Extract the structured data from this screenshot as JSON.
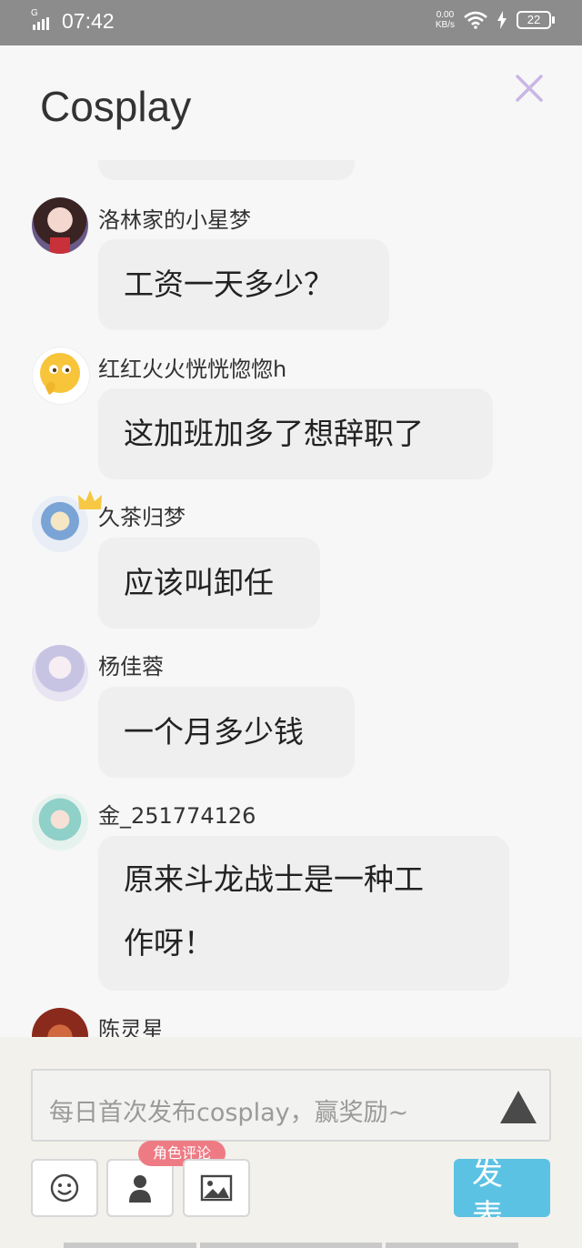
{
  "status_bar": {
    "network_type": "G",
    "time": "07:42",
    "net_speed_value": "0.00",
    "net_speed_unit": "KB/s",
    "battery": "22"
  },
  "header": {
    "title": "Cosplay"
  },
  "messages": [
    {
      "name": "洛林家的小星梦",
      "text": "工资一天多少？"
    },
    {
      "name": "红红火火恍恍惚惚h",
      "text": "这加班加多了想辞职了"
    },
    {
      "name": "久茶归梦",
      "text": "应该叫卸任"
    },
    {
      "name": "杨佳蓉",
      "text": "一个月多少钱"
    },
    {
      "name": "金_251774126",
      "text_line1": "原来斗龙战士是一种工",
      "text_line2": "作呀！"
    },
    {
      "name": "陈灵星"
    }
  ],
  "composer": {
    "placeholder": "每日首次发布cosplay，赢奖励~",
    "role_badge": "角色评论",
    "post_label_line1": "发",
    "post_label_line2": "表"
  },
  "colors": {
    "status_bar": "#8c8c8c",
    "bubble": "#efefef",
    "post_button": "#5bc2e4",
    "role_badge": "#ee7b84",
    "close_icon": "#c9b6e6"
  }
}
